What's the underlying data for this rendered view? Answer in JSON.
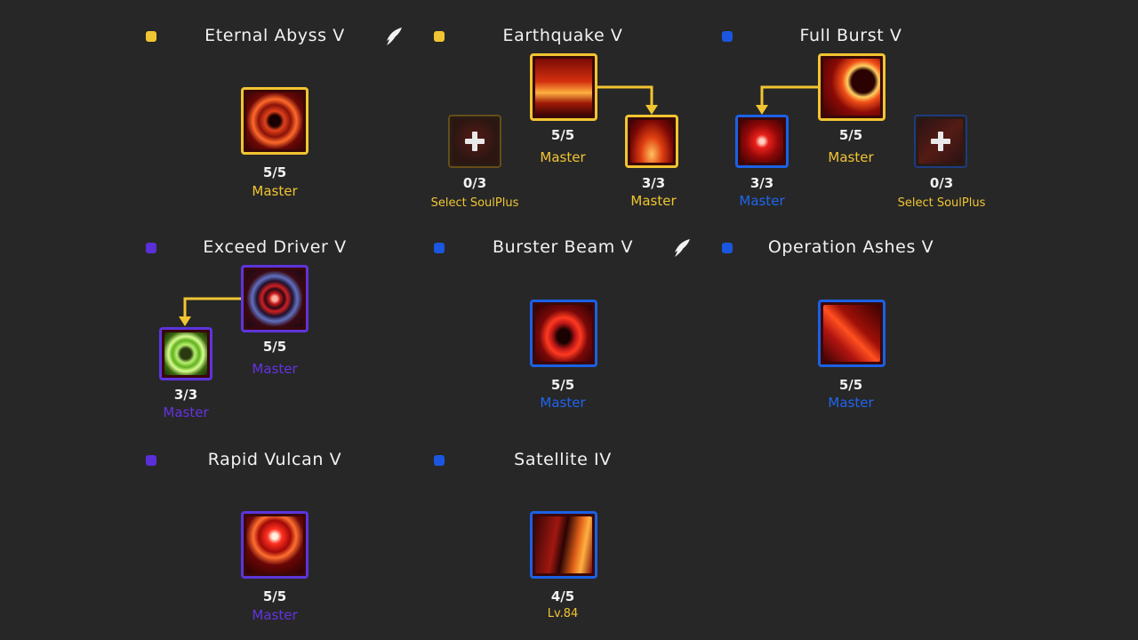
{
  "colors": {
    "gold": "#f1c531",
    "blue": "#1b61e6",
    "purple": "#5c35dc",
    "background": "#272727"
  },
  "skills": {
    "eternal_abyss": {
      "name": "Eternal Abyss V",
      "level": "5/5",
      "rank": "Master",
      "icon": "dark-vortex-icon"
    },
    "earthquake": {
      "name": "Earthquake V",
      "level": "5/5",
      "rank": "Master",
      "icon": "ground-explosion-icon",
      "soulplus": {
        "level": "0/3",
        "label": "Select SoulPlus"
      },
      "sub": {
        "level": "3/3",
        "rank": "Master",
        "icon": "eruption-icon"
      }
    },
    "full_burst": {
      "name": "Full Burst V",
      "level": "5/5",
      "rank": "Master",
      "icon": "crescent-slash-icon",
      "sub": {
        "level": "3/3",
        "rank": "Master",
        "icon": "laser-cross-icon"
      },
      "soulplus": {
        "level": "0/3",
        "label": "Select SoulPlus"
      }
    },
    "exceed_driver": {
      "name": "Exceed Driver V",
      "level": "5/5",
      "rank": "Master",
      "icon": "target-circle-icon",
      "sub": {
        "level": "3/3",
        "rank": "Master",
        "icon": "green-ring-icon"
      }
    },
    "burster_beam": {
      "name": "Burster Beam V",
      "level": "5/5",
      "rank": "Master",
      "icon": "beam-mech-icon"
    },
    "operation_ashes": {
      "name": "Operation Ashes V",
      "level": "5/5",
      "rank": "Master",
      "icon": "crossed-blades-icon"
    },
    "rapid_vulcan": {
      "name": "Rapid Vulcan V",
      "level": "5/5",
      "rank": "Master",
      "icon": "vulcan-burst-icon"
    },
    "satellite": {
      "name": "Satellite IV",
      "level": "4/5",
      "rank": "Lv.84",
      "icon": "character-portrait-icon"
    }
  }
}
